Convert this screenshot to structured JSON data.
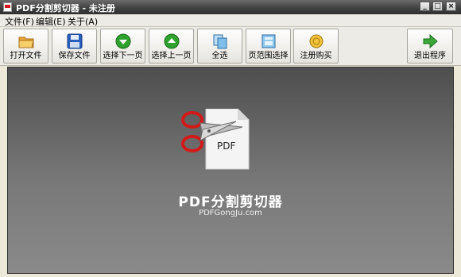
{
  "window": {
    "title": "PDF分割剪切器 - 未注册",
    "controls": {
      "minimize": "_",
      "maximize": "□",
      "close": "×"
    }
  },
  "menu": [
    {
      "label": "文件(F)"
    },
    {
      "label": "编辑(E)"
    },
    {
      "label": "关于(A)"
    }
  ],
  "toolbar": {
    "open_label": "打开文件",
    "save_label": "保存文件",
    "next_page_label": "选择下一页",
    "prev_page_label": "选择上一页",
    "select_all_label": "全选",
    "page_range_label": "页范围选择",
    "register_label": "注册购买",
    "exit_label": "退出程序"
  },
  "main": {
    "logo_badge": "PDF",
    "app_name": "PDF分割剪切器",
    "app_url": "PDFGongJu.com"
  },
  "colors": {
    "scissors_red": "#d21a1a",
    "green_icon": "#2ea12e",
    "background_dark": "#4e4e4e"
  }
}
